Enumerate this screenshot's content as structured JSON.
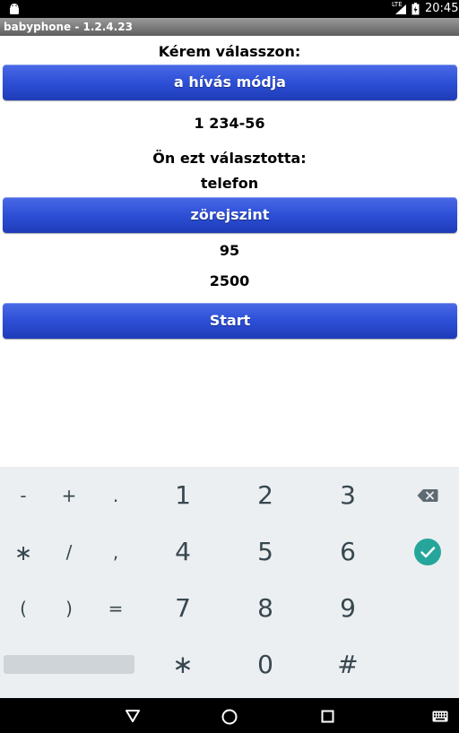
{
  "status_bar": {
    "network": "LTE",
    "time": "20:45"
  },
  "app": {
    "title": "babyphone - 1.2.4.23"
  },
  "content": {
    "prompt": "Kérem válasszon:",
    "call_mode_button": "a hívás módja",
    "phone_number": "1 234-56",
    "selected_label": "Ön ezt választotta:",
    "selected_value": "telefon",
    "noise_button": "zörejszint",
    "noise_value": "95",
    "duration_value": "2500",
    "start_button": "Start"
  },
  "keyboard": {
    "row1": {
      "s1": "-",
      "s2": "+",
      "s3": ".",
      "n1": "1",
      "n2": "2",
      "n3": "3"
    },
    "row2": {
      "s1": "∗",
      "s2": "/",
      "s3": ",",
      "n1": "4",
      "n2": "5",
      "n3": "6"
    },
    "row3": {
      "s1": "(",
      "s2": ")",
      "s3": "=",
      "n1": "7",
      "n2": "8",
      "n3": "9"
    },
    "row4": {
      "n1": "∗",
      "n2": "0",
      "n3": "#"
    },
    "icons": {
      "backspace": "backspace-icon",
      "done": "check-circle-icon"
    },
    "colors": {
      "background": "#eceff1",
      "key_text": "#37474f",
      "done_accent": "#26a69a"
    }
  },
  "nav_bar": {
    "icons": [
      "back-triangle-icon",
      "home-circle-icon",
      "recents-square-icon",
      "keyboard-icon"
    ]
  },
  "colors": {
    "button_blue": "#2d4fd6",
    "title_bar_gray": "#7a7a7a"
  }
}
